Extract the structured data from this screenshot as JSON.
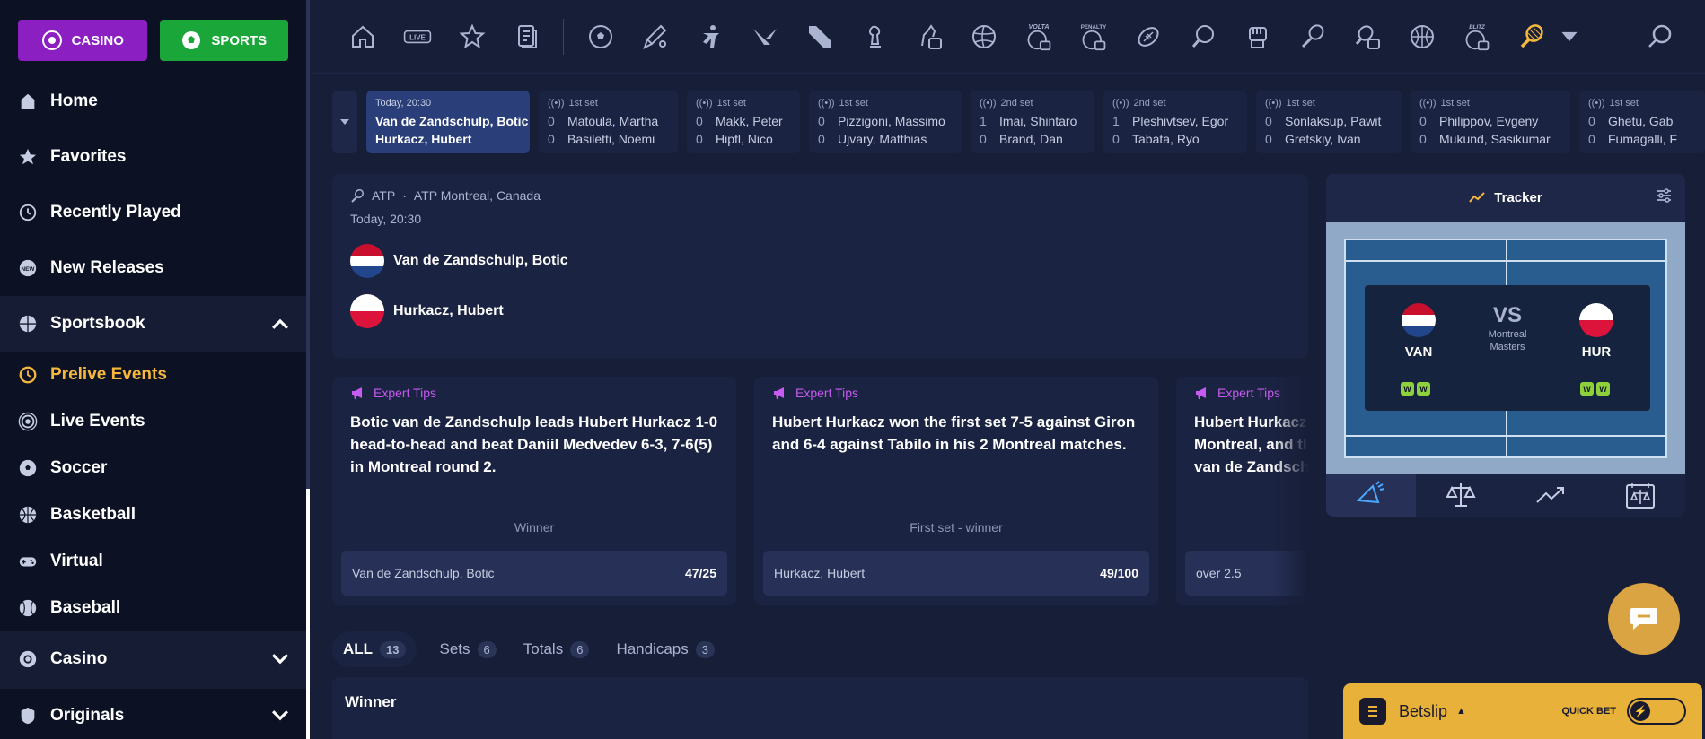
{
  "top_buttons": {
    "casino": "CASINO",
    "sports": "SPORTS"
  },
  "sidebar": {
    "items": [
      {
        "label": "Home"
      },
      {
        "label": "Favorites"
      },
      {
        "label": "Recently Played"
      },
      {
        "label": "New Releases"
      },
      {
        "label": "Sportsbook"
      },
      {
        "label": "Prelive Events"
      },
      {
        "label": "Live Events"
      },
      {
        "label": "Soccer"
      },
      {
        "label": "Basketball"
      },
      {
        "label": "Virtual"
      },
      {
        "label": "Baseball"
      },
      {
        "label": "Casino"
      },
      {
        "label": "Originals"
      }
    ]
  },
  "iconbar": {
    "live_label": "LIVE",
    "volta_label": "VOLTA",
    "penalty_label": "PENALTY",
    "blitz_label": "BLITZ",
    "icons": [
      "home-icon",
      "live-icon",
      "star-icon",
      "coupon-icon",
      "soccer-icon",
      "cricket-icon",
      "shooter-icon",
      "valorant-icon",
      "dota-icon",
      "chess-icon",
      "efootball-icon",
      "volleyball-icon",
      "volta-icon",
      "penalty-icon",
      "rugby-icon",
      "table-tennis-icon",
      "fist-icon",
      "badminton-icon",
      "ebasketball-icon",
      "basketball-icon",
      "blitz-icon",
      "tennis-icon"
    ],
    "accent": "#f5b73d"
  },
  "strip": {
    "selected": {
      "time": "Today, 20:30",
      "home": "Van de Zandschulp, Botic",
      "away": "Hurkacz, Hubert"
    },
    "matches": [
      {
        "status": "1st set",
        "home_score": "0",
        "home": "Matoula, Martha",
        "away_score": "0",
        "away": "Basiletti, Noemi"
      },
      {
        "status": "1st set",
        "home_score": "0",
        "home": "Makk, Peter",
        "away_score": "0",
        "away": "Hipfl, Nico"
      },
      {
        "status": "1st set",
        "home_score": "0",
        "home": "Pizzigoni, Massimo",
        "away_score": "0",
        "away": "Ujvary, Matthias"
      },
      {
        "status": "2nd set",
        "home_score": "1",
        "home": "Imai, Shintaro",
        "away_score": "0",
        "away": "Brand, Dan"
      },
      {
        "status": "2nd set",
        "home_score": "1",
        "home": "Pleshivtsev, Egor",
        "away_score": "0",
        "away": "Tabata, Ryo"
      },
      {
        "status": "1st set",
        "home_score": "0",
        "home": "Sonlaksup, Pawit",
        "away_score": "0",
        "away": "Gretskiy, Ivan"
      },
      {
        "status": "1st set",
        "home_score": "0",
        "home": "Philippov, Evgeny",
        "away_score": "0",
        "away": "Mukund, Sasikumar"
      },
      {
        "status": "1st set",
        "home_score": "0",
        "home": "Ghetu, Gab",
        "away_score": "0",
        "away": "Fumagalli, F"
      }
    ]
  },
  "event": {
    "tour": "ATP",
    "tournament": "ATP Montreal, Canada",
    "time": "Today, 20:30",
    "home": "Van de Zandschulp, Botic",
    "away": "Hurkacz, Hubert"
  },
  "tips": [
    {
      "head": "Expert Tips",
      "text": "Botic van de Zandschulp leads Hubert Hurkacz 1-0 head-to-head and beat Daniil Medvedev 6-3, 7-6(5) in Montreal round 2.",
      "market": "Winner",
      "selection": "Van de Zandschulp, Botic",
      "odds": "47/25"
    },
    {
      "head": "Expert Tips",
      "text": "Hubert Hurkacz won the first set 7-5 against Giron and 6-4 against Tabilo in his 2 Montreal matches.",
      "market": "First set - winner",
      "selection": "Hurkacz, Hubert",
      "odds": "49/100"
    },
    {
      "head": "Expert Tips",
      "text": "Hubert Hurkacz\nMontreal, and th\nvan de Zandschu",
      "market": "",
      "selection": "over 2.5",
      "odds": ""
    }
  ],
  "market_tabs": [
    {
      "label": "ALL",
      "count": "13"
    },
    {
      "label": "Sets",
      "count": "6"
    },
    {
      "label": "Totals",
      "count": "6"
    },
    {
      "label": "Handicaps",
      "count": "3"
    }
  ],
  "winner_section": {
    "title": "Winner"
  },
  "tracker": {
    "title": "Tracker",
    "home_abbr": "VAN",
    "away_abbr": "HUR",
    "vs": "VS",
    "venue_line1": "Montreal",
    "venue_line2": "Masters",
    "badge": "W"
  },
  "betslip": {
    "label": "Betslip",
    "quick_bet": "QUICK BET"
  }
}
